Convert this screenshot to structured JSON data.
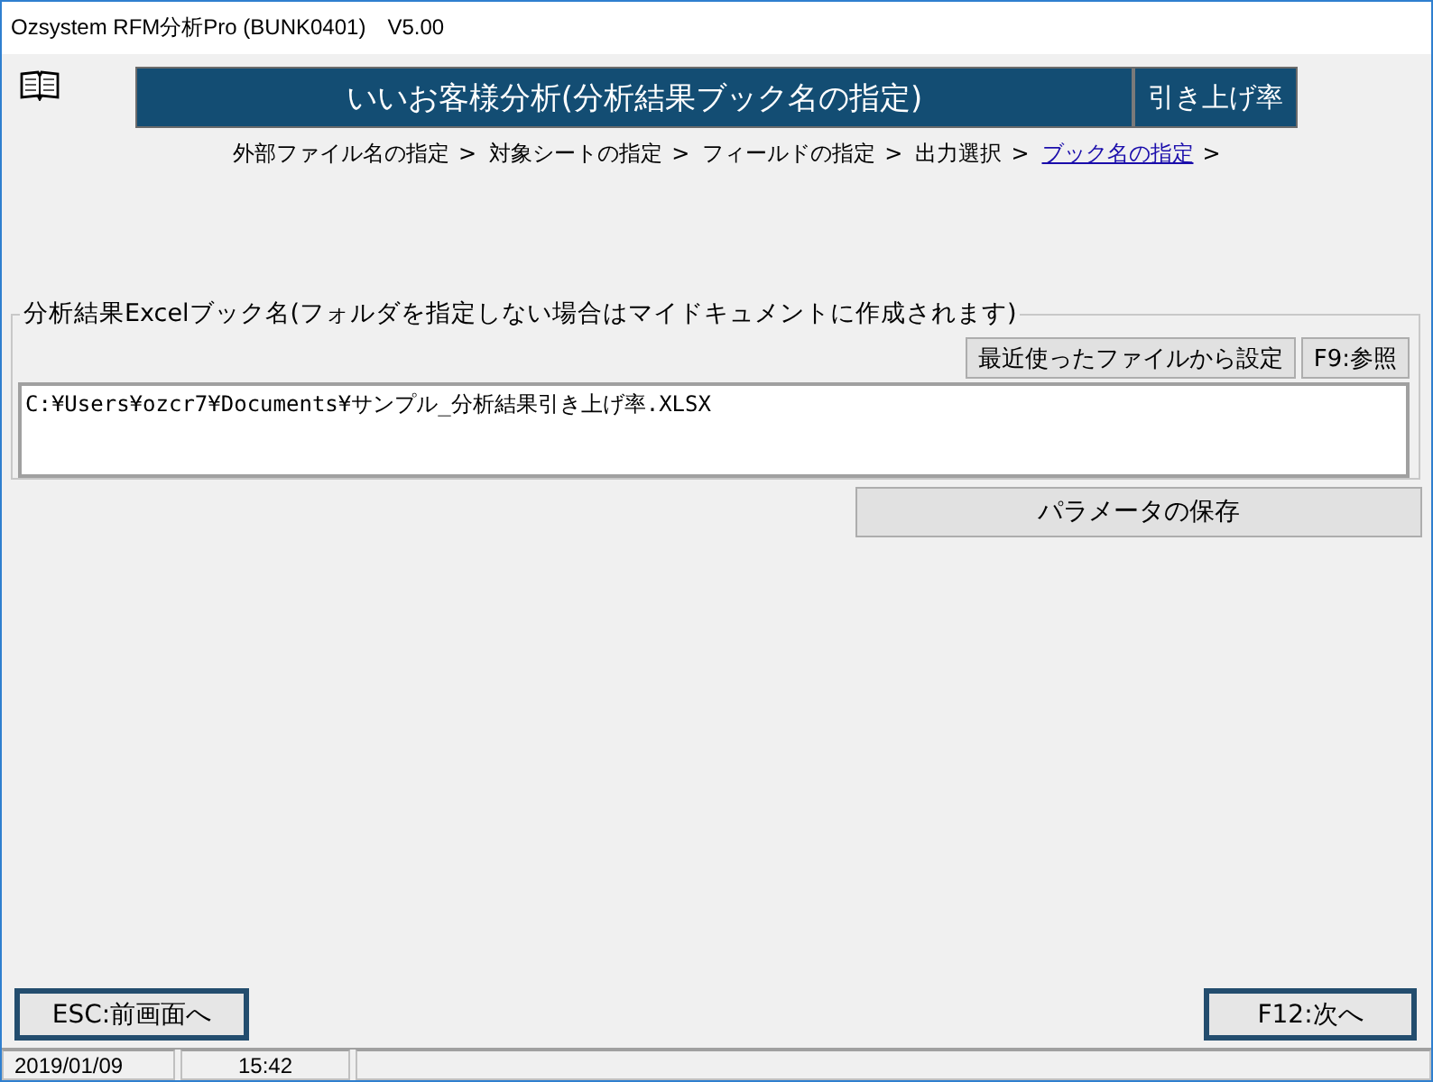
{
  "window": {
    "title": "Ozsystem RFM分析Pro (BUNK0401)　V5.00"
  },
  "header": {
    "title": "いいお客様分析(分析結果ブック名の指定)",
    "mode": "引き上げ率"
  },
  "breadcrumb": [
    {
      "label": "外部ファイル名の指定",
      "separator": ">",
      "current": false
    },
    {
      "label": "対象シートの指定",
      "separator": ">",
      "current": false
    },
    {
      "label": "フィールドの指定",
      "separator": ">",
      "current": false
    },
    {
      "label": "出力選択",
      "separator": ">",
      "current": false
    },
    {
      "label": "ブック名の指定",
      "separator": ">",
      "current": true
    }
  ],
  "output_group": {
    "legend": "分析結果Excelブック名(フォルダを指定しない場合はマイドキュメントに作成されます)",
    "buttons": [
      "最近使ったファイルから設定",
      "F9:参照"
    ],
    "path": "C:¥Users¥ozcr7¥Documents¥サンプル_分析結果引き上げ率.XLSX"
  },
  "save_button": "パラメータの保存",
  "nav_buttons": {
    "back": "ESC:前画面へ",
    "next": "F12:次へ"
  },
  "status_bar": [
    "2019/01/09",
    "15:42"
  ]
}
